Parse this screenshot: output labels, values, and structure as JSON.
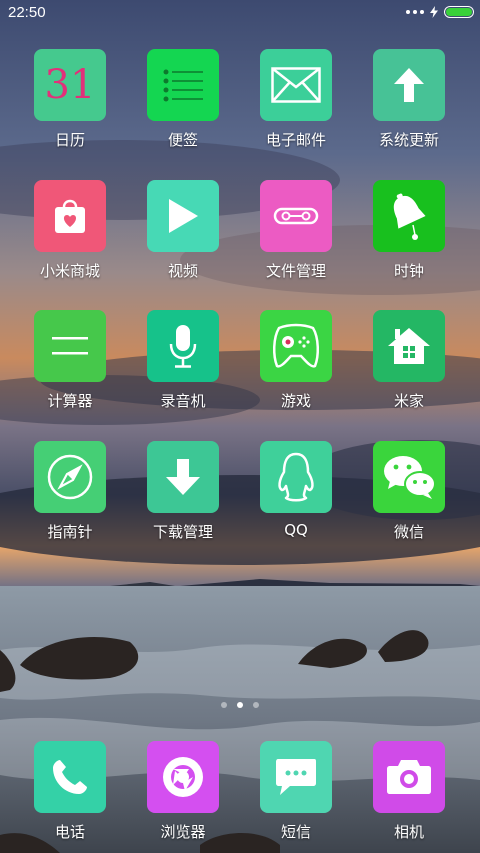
{
  "status": {
    "time": "22:50"
  },
  "apps": [
    {
      "id": "calendar",
      "label": "日历",
      "day": "31",
      "color": "#45c98e",
      "icon": "calendar-icon"
    },
    {
      "id": "notes",
      "label": "便签",
      "color": "#14d651",
      "icon": "notes-icon"
    },
    {
      "id": "email",
      "label": "电子邮件",
      "color": "#3ccf99",
      "icon": "mail-icon"
    },
    {
      "id": "update",
      "label": "系统更新",
      "color": "#47c296",
      "icon": "up-arrow-icon"
    },
    {
      "id": "mall",
      "label": "小米商城",
      "color": "#f05778",
      "icon": "shopping-bag-icon"
    },
    {
      "id": "video",
      "label": "视频",
      "color": "#47d9b5",
      "icon": "play-icon"
    },
    {
      "id": "files",
      "label": "文件管理",
      "color": "#ec5bc3",
      "icon": "tape-icon"
    },
    {
      "id": "clock",
      "label": "时钟",
      "color": "#18c01e",
      "icon": "bell-icon"
    },
    {
      "id": "calculator",
      "label": "计算器",
      "color": "#46c84b",
      "icon": "equals-icon"
    },
    {
      "id": "recorder",
      "label": "录音机",
      "color": "#16c28a",
      "icon": "microphone-icon"
    },
    {
      "id": "games",
      "label": "游戏",
      "color": "#3bd544",
      "icon": "gamepad-icon"
    },
    {
      "id": "mihome",
      "label": "米家",
      "color": "#24b764",
      "icon": "house-icon"
    },
    {
      "id": "compass",
      "label": "指南针",
      "color": "#45cf75",
      "icon": "compass-icon"
    },
    {
      "id": "downloads",
      "label": "下载管理",
      "color": "#3dc795",
      "icon": "download-arrow-icon"
    },
    {
      "id": "qq",
      "label": "QQ",
      "color": "#3fd09a",
      "icon": "penguin-icon"
    },
    {
      "id": "wechat",
      "label": "微信",
      "color": "#3ad53c",
      "icon": "chat-bubbles-icon"
    }
  ],
  "dock": [
    {
      "id": "phone",
      "label": "电话",
      "color": "#34d1a7",
      "icon": "phone-icon"
    },
    {
      "id": "browser",
      "label": "浏览器",
      "color": "#d44ff0",
      "icon": "browser-icon"
    },
    {
      "id": "sms",
      "label": "短信",
      "color": "#4fd6b1",
      "icon": "message-icon"
    },
    {
      "id": "camera",
      "label": "相机",
      "color": "#d04be8",
      "icon": "camera-icon"
    }
  ],
  "pager": {
    "count": 3,
    "active_index": 1
  }
}
